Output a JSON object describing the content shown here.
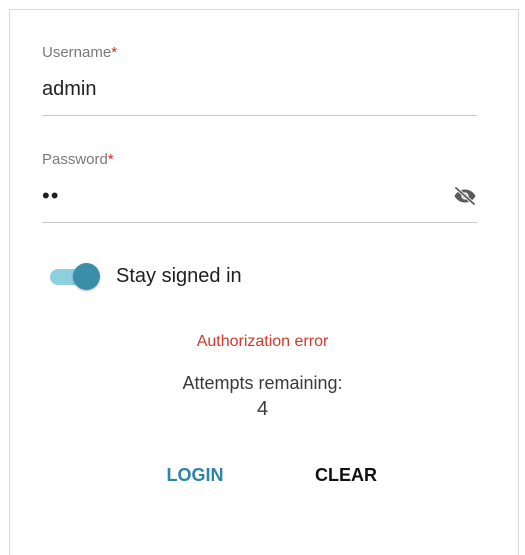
{
  "form": {
    "username": {
      "label": "Username",
      "required_mark": "*",
      "value": "admin"
    },
    "password": {
      "label": "Password",
      "required_mark": "*",
      "value": "••",
      "visibility_icon": "eye-off-icon"
    },
    "stay_signed_in": {
      "label": "Stay signed in",
      "checked": true
    },
    "error_message": "Authorization error",
    "attempts_label": "Attempts remaining:",
    "attempts_count": "4",
    "buttons": {
      "login_label": "LOGIN",
      "clear_label": "CLEAR"
    }
  },
  "colors": {
    "accent": "#2a86a4",
    "error": "#d1392b",
    "required": "#e02020",
    "toggle_track": "#8ccfdf",
    "toggle_knob": "#3a8ea8"
  }
}
